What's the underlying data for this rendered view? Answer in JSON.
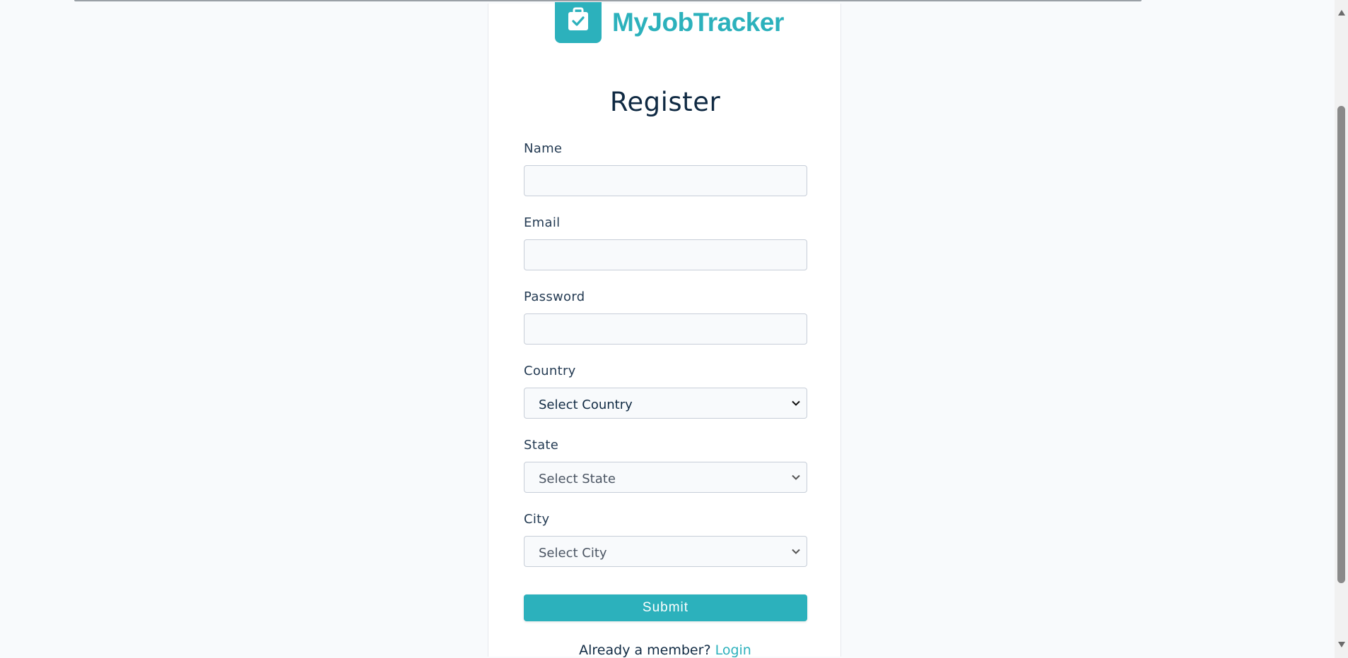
{
  "brand": {
    "name": "MyJobTracker",
    "logo_icon": "briefcase-check-icon",
    "color": "#2cb1bc"
  },
  "form": {
    "title": "Register",
    "fields": {
      "name": {
        "label": "Name",
        "value": ""
      },
      "email": {
        "label": "Email",
        "value": ""
      },
      "password": {
        "label": "Password",
        "value": ""
      },
      "country": {
        "label": "Country",
        "selected": "Select Country"
      },
      "state": {
        "label": "State",
        "selected": "Select State"
      },
      "city": {
        "label": "City",
        "selected": "Select City"
      }
    },
    "submit_label": "Submit",
    "footer_text": "Already a member?",
    "footer_link": "Login"
  }
}
